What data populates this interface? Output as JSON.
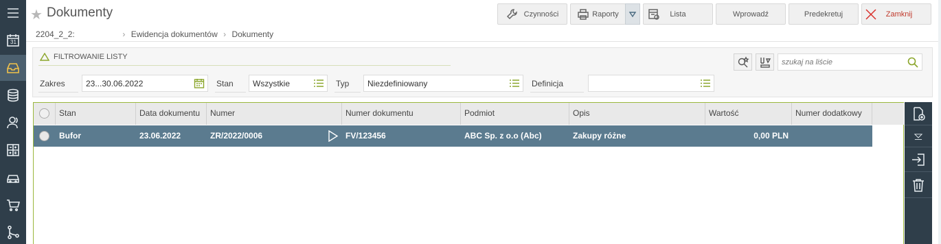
{
  "header": {
    "title": "Dokumenty",
    "breadcrumb": [
      "2204_2_2:",
      "Ewidencja dokumentów",
      "Dokumenty"
    ]
  },
  "toolbar": {
    "czynnosci": "Czynności",
    "raporty": "Raporty",
    "lista": "Lista",
    "wprowadz": "Wprowadź",
    "predekretuj": "Predekretuj",
    "zamknij": "Zamknij"
  },
  "left_nav": {
    "icons": [
      "menu-icon",
      "calendar-icon",
      "inbox-icon",
      "coins-icon",
      "users-icon",
      "calculator-icon",
      "car-icon",
      "cart-icon",
      "workflow-icon"
    ],
    "calendar_day": "31",
    "active": "inbox-icon"
  },
  "filter": {
    "section_label": "FILTROWANIE LISTY",
    "zakres_label": "Zakres",
    "zakres_value": "23...30.06.2022",
    "stan_label": "Stan",
    "stan_value": "Wszystkie",
    "typ_label": "Typ",
    "typ_value": "Niezdefiniowany",
    "definicja_label": "Definicja",
    "definicja_value": "",
    "search_placeholder": "szukaj na liście"
  },
  "grid": {
    "columns": [
      "Stan",
      "Data dokumentu",
      "Numer",
      "Numer dokumentu",
      "Podmiot",
      "Opis",
      "Wartość",
      "Numer dodatkowy"
    ],
    "rows": [
      {
        "stan": "Bufor",
        "data": "23.06.2022",
        "numer": "ZR/2022/0006",
        "numer_dokumentu": "FV/123456",
        "podmiot": "ABC Sp. z o.o (Abc)",
        "opis": "Zakupy różne",
        "wartosc": "0,00 PLN",
        "numer_dodatkowy": ""
      }
    ]
  },
  "right_actions": [
    "add-document-icon",
    "filter-down-icon",
    "import-icon",
    "trash-icon"
  ],
  "colors": {
    "nav_bg": "#2f3e4a",
    "accent_green": "#8aa52a",
    "selected_row": "#5b7b8f",
    "close_red": "#d9302b"
  }
}
